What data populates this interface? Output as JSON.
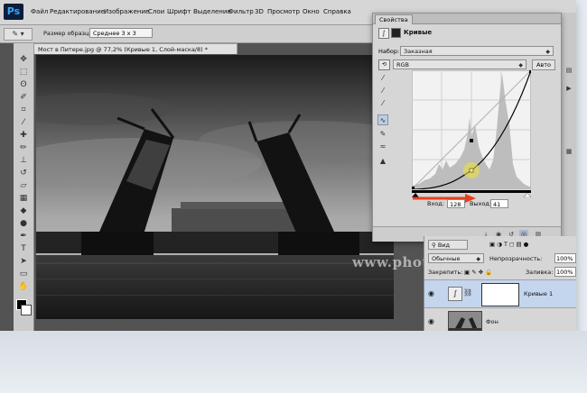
{
  "app": {
    "logo": "Ps",
    "menu": [
      "Файл",
      "Редактирование",
      "Изображение",
      "Слои",
      "Шрифт",
      "Выделение",
      "Фильтр",
      "3D",
      "Просмотр",
      "Окно",
      "Справка"
    ]
  },
  "options_bar": {
    "sample_size_label": "Размер образца:",
    "sample_size_value": "Среднее 3 x 3"
  },
  "document": {
    "tab_title": "Мост в Питере.jpg @ 77,2% (Кривые 1, Слой-маска/8) *",
    "close_glyph": "×",
    "watermark": "www.photoshop-master.ru"
  },
  "properties": {
    "panel_tab": "Свойства",
    "adjustment_title": "Кривые",
    "preset_label": "Набор:",
    "preset_value": "Заказная",
    "channel_value": "RGB",
    "auto_label": "Авто",
    "input_label": "Вход:",
    "input_value": "128",
    "output_label": "Выход:",
    "output_value": "41",
    "curve_point": {
      "input": 128,
      "output": 41
    }
  },
  "layers": {
    "kind_label": "Вид",
    "blend_mode": "Обычные",
    "opacity_label": "Непрозрачность:",
    "opacity_value": "100%",
    "lock_label": "Закрепить:",
    "fill_label": "Заливка:",
    "fill_value": "100%",
    "items": [
      {
        "name": "Кривые 1",
        "selected": true
      },
      {
        "name": "Фон",
        "selected": false
      }
    ]
  },
  "colors": {
    "accent_arrow": "#e8401c",
    "highlight": "#f0e33a",
    "selection": "#c4d5ee"
  },
  "icons": {
    "tool_preset": "dropper-icon",
    "curve_tools": [
      "sample-black-icon",
      "sample-gray-icon",
      "sample-white-icon",
      "curve-edit-icon",
      "pencil-icon",
      "smooth-icon",
      "histogram-warning-icon"
    ]
  }
}
